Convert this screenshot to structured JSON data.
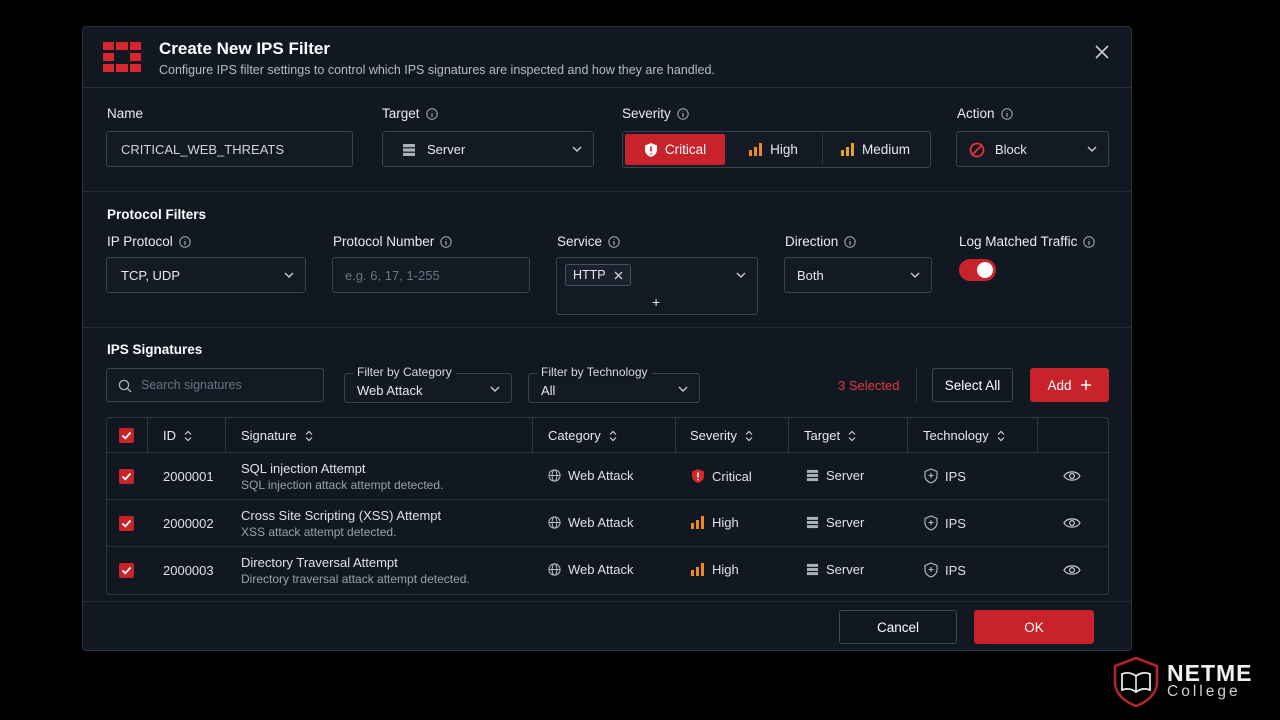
{
  "dialog": {
    "title": "Create New IPS Filter",
    "subtitle": "Configure IPS filter settings to control which IPS signatures are inspected and how they are handled."
  },
  "general": {
    "name_label": "Name",
    "name_value": "CRITICAL_WEB_THREATS",
    "target_label": "Target",
    "target_value": "Server",
    "severity_label": "Severity",
    "severity_options": [
      "Critical",
      "High",
      "Medium"
    ],
    "severity_selected": "Critical",
    "action_label": "Action",
    "action_value": "Block"
  },
  "protocol": {
    "section_title": "Protocol Filters",
    "ip_protocol_label": "IP Protocol",
    "ip_protocol_value": "TCP, UDP",
    "protocol_number_label": "Protocol Number",
    "protocol_number_placeholder": "e.g. 6, 17, 1-255",
    "service_label": "Service",
    "service_chip": "HTTP",
    "service_add": "+",
    "direction_label": "Direction",
    "direction_value": "Both",
    "log_label": "Log Matched Traffic",
    "log_enabled": true
  },
  "signatures": {
    "section_title": "IPS Signatures",
    "search_placeholder": "Search signatures",
    "category_filter_label": "Filter by Category",
    "category_filter_value": "Web Attack",
    "technology_filter_label": "Filter by Technology",
    "technology_filter_value": "All",
    "selected_text": "3 Selected",
    "select_all_label": "Select All",
    "add_label": "Add",
    "columns": [
      "ID",
      "Signature",
      "Category",
      "Severity",
      "Target",
      "Technology"
    ],
    "rows": [
      {
        "id": "2000001",
        "name": "SQL injection Attempt",
        "desc": "SQL injection attack attempt detected.",
        "category": "Web Attack",
        "severity": "Critical",
        "target": "Server",
        "technology": "IPS"
      },
      {
        "id": "2000002",
        "name": "Cross Site Scripting (XSS) Attempt",
        "desc": "XSS attack attempt detected.",
        "category": "Web Attack",
        "severity": "High",
        "target": "Server",
        "technology": "IPS"
      },
      {
        "id": "2000003",
        "name": "Directory Traversal Attempt",
        "desc": "Directory traversal attack attempt detected.",
        "category": "Web Attack",
        "severity": "High",
        "target": "Server",
        "technology": "IPS"
      }
    ]
  },
  "footer": {
    "cancel_label": "Cancel",
    "ok_label": "OK"
  },
  "watermark": {
    "line1": "NETME",
    "line2": "College"
  },
  "colors": {
    "accent": "#c8222a",
    "background": "#121822",
    "high_severity": "#f08a24"
  }
}
